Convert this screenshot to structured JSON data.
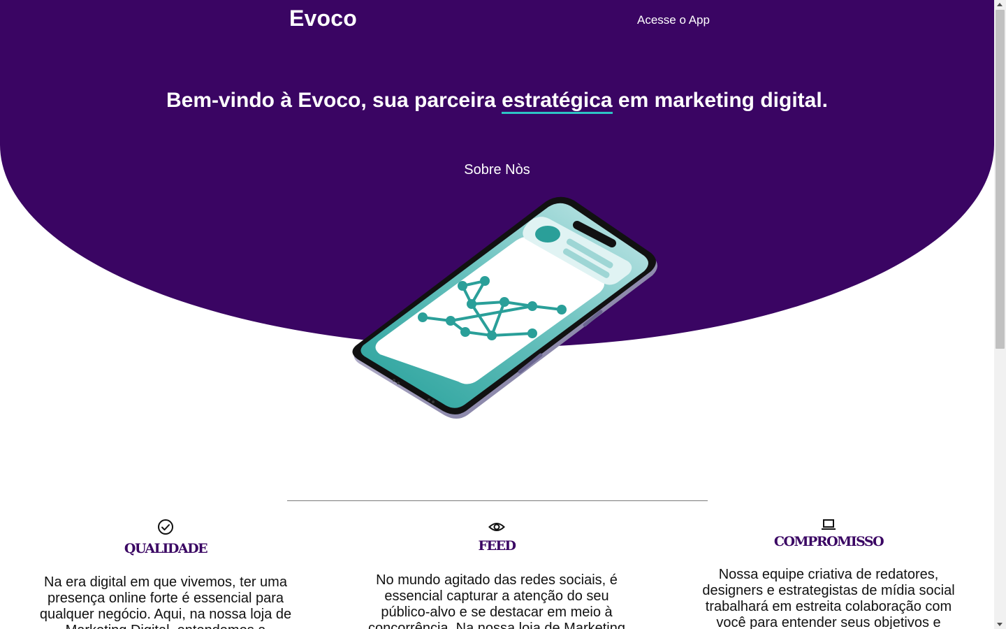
{
  "header": {
    "brand": "Evoco",
    "nav_app_link": "Acesse o App"
  },
  "hero": {
    "headline_before": "Bem-vindo à Evoco, sua parceira ",
    "headline_highlight": "estratégica",
    "headline_after": " em marketing digital.",
    "about_button": "Sobre Nòs",
    "illustration_icon": "smartphone-network-illustration"
  },
  "features": [
    {
      "icon": "check-circle-icon",
      "title": "QUALIDADE",
      "text": "Na era digital em que vivemos, ter uma presença online forte é essencial para qualquer negócio. Aqui, na nossa loja de Marketing Digital, entendemos a"
    },
    {
      "icon": "eye-icon",
      "title": "FEED",
      "text": "No mundo agitado das redes sociais, é essencial capturar a atenção do seu público-alvo e se destacar em meio à concorrência. Na nossa loja de Marketing"
    },
    {
      "icon": "laptop-icon",
      "title": "COMPROMISSO",
      "text": "Nossa equipe criativa de redatores, designers e estrategistas de mídia social trabalhará em estreita colaboração com você para entender seus objetivos e"
    }
  ],
  "colors": {
    "hero_bg": "#3a0563",
    "accent": "#2ec4c4",
    "title": "#3a0563"
  }
}
